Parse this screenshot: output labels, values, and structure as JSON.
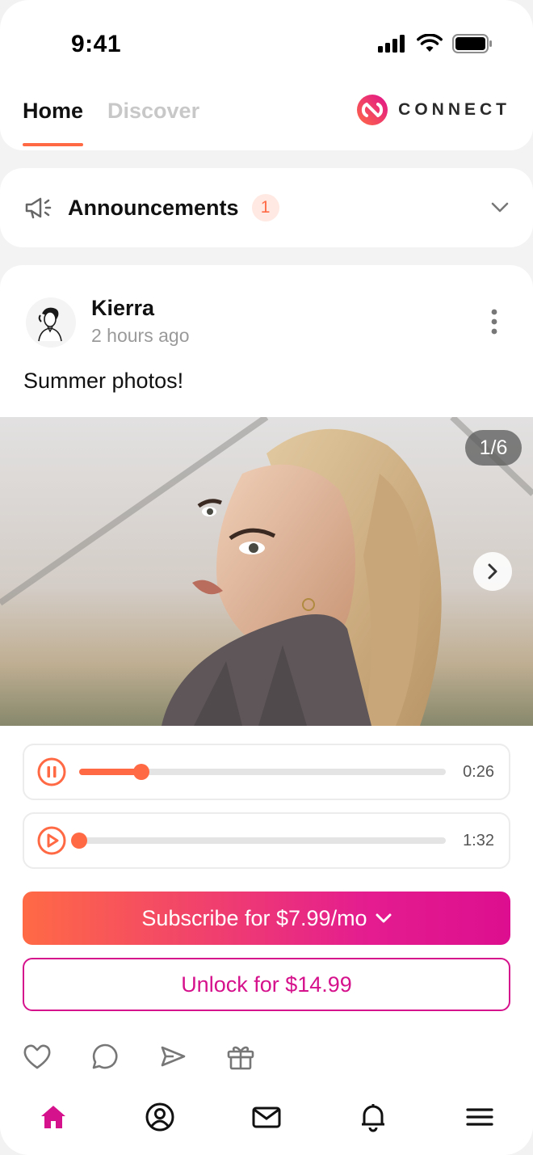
{
  "status": {
    "time": "9:41"
  },
  "header": {
    "tabs": [
      {
        "label": "Home",
        "active": true
      },
      {
        "label": "Discover",
        "active": false
      }
    ],
    "brand": "CONNECT"
  },
  "announcements": {
    "title": "Announcements",
    "count": "1"
  },
  "post": {
    "author": "Kierra",
    "time_ago": "2 hours ago",
    "caption": "Summer photos!",
    "media_counter": "1/6",
    "audio": [
      {
        "state": "playing",
        "progress": 0.17,
        "duration": "0:26"
      },
      {
        "state": "paused",
        "progress": 0.0,
        "duration": "1:32"
      }
    ],
    "subscribe_label": "Subscribe for $7.99/mo",
    "unlock_label": "Unlock for $14.99"
  },
  "colors": {
    "accent": "#ff6a45",
    "brand_pink": "#d6118c"
  },
  "icons": {
    "actions": [
      "heart-icon",
      "comment-icon",
      "send-icon",
      "gift-icon"
    ],
    "nav": [
      "home-icon",
      "profile-icon",
      "mail-icon",
      "bell-icon",
      "menu-icon"
    ]
  }
}
